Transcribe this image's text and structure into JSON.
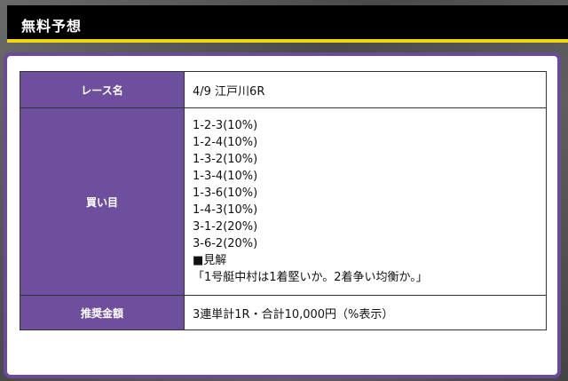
{
  "header": {
    "title": "無料予想"
  },
  "table": {
    "race_name_label": "レース名",
    "race_name_value": "4/9 江戸川6R",
    "bets_label": "買い目",
    "bets": [
      "1-2-3(10%)",
      "1-2-4(10%)",
      "1-3-2(10%)",
      "1-3-4(10%)",
      "1-3-6(10%)",
      "1-4-3(10%)",
      "3-1-2(20%)",
      "3-6-2(20%)"
    ],
    "opinion_heading": "■見解",
    "opinion_text": "「1号艇中村は1着堅いか。2着争い均衡か。」",
    "recommended_amount_label": "推奨金額",
    "recommended_amount_value": "3連単計1R・合計10,000円（%表示）"
  },
  "colors": {
    "header_bg": "#000000",
    "header_accent": "#f2d70a",
    "label_bg": "#6e4f9e",
    "card_border": "#6a4a9a"
  }
}
